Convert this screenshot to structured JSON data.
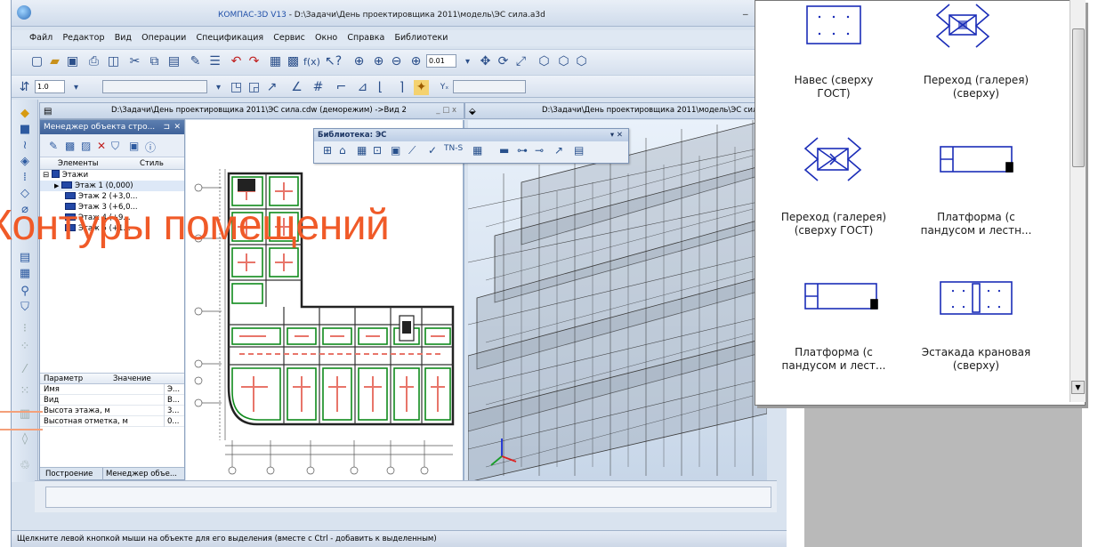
{
  "window": {
    "app_name": "КОМПАС-3D V13",
    "title": " - D:\\Задачи\\День проектировщика 2011\\модель\\ЭС сила.a3d",
    "minimize": "_"
  },
  "menu": [
    "Файл",
    "Редактор",
    "Вид",
    "Операции",
    "Спецификация",
    "Сервис",
    "Окно",
    "Справка",
    "Библиотеки"
  ],
  "toolbar": {
    "scale_value": "1.0",
    "zoom_value": "0.01",
    "snap_value": ""
  },
  "manager": {
    "title": "Менеджер объекта стро...",
    "pin": "⊐",
    "close": "✕",
    "col_elements": "Элементы",
    "col_style": "Стиль",
    "root": "Этажи",
    "floors": [
      "Этаж 1 (0,000)",
      "Этаж 2 (+3,0...",
      "Этаж 3 (+6,0...",
      "Этаж 4 (+9...",
      "Этаж 5 (+1..."
    ],
    "param_header": "Параметр",
    "value_header": "Значение",
    "params": [
      {
        "name": "Имя",
        "value": "Э..."
      },
      {
        "name": "Вид",
        "value": "В..."
      },
      {
        "name": "Высота этажа, м",
        "value": "3..."
      },
      {
        "name": "Высотная отметка, м",
        "value": "0..."
      }
    ],
    "tab_build": "Построение",
    "tab_manager": "Менеджер объе..."
  },
  "doc_window": {
    "title": "D:\\Задачи\\День проектировщика 2011\\ЭС сила.cdw (деморежим) ->Вид 2",
    "controls": "_ □ x"
  },
  "view3d_window": {
    "title": "D:\\Задачи\\День проектировщика 2011\\модель\\ЭС сил"
  },
  "library": {
    "title": "Библиотека: ЭС",
    "controls": "▾ ✕"
  },
  "status": "Щелкните левой кнопкой мыши на объекте для его выделения (вместе с Ctrl - добавить к выделенным)",
  "caption": "Контуры помещений",
  "catalog": {
    "items": [
      {
        "label_1": "Навес (сверху",
        "label_2": "ГОСТ)"
      },
      {
        "label_1": "Переход (галерея)",
        "label_2": "(сверху)"
      },
      {
        "label_1": "Переход (галерея)",
        "label_2": "(сверху ГОСТ)"
      },
      {
        "label_1": "Платформа (с",
        "label_2": "пандусом и лестн..."
      },
      {
        "label_1": "Платформа (с",
        "label_2": "пандусом и лест..."
      },
      {
        "label_1": "Эстакада крановая",
        "label_2": "(сверху)"
      }
    ],
    "scroll_down": "▼"
  },
  "colors": {
    "caption": "#f05a28",
    "symbol_stroke": "#1b2db8",
    "floor_icon": "#2348a6",
    "wall_green": "#0f8a1c",
    "room_red": "#e8756a"
  }
}
